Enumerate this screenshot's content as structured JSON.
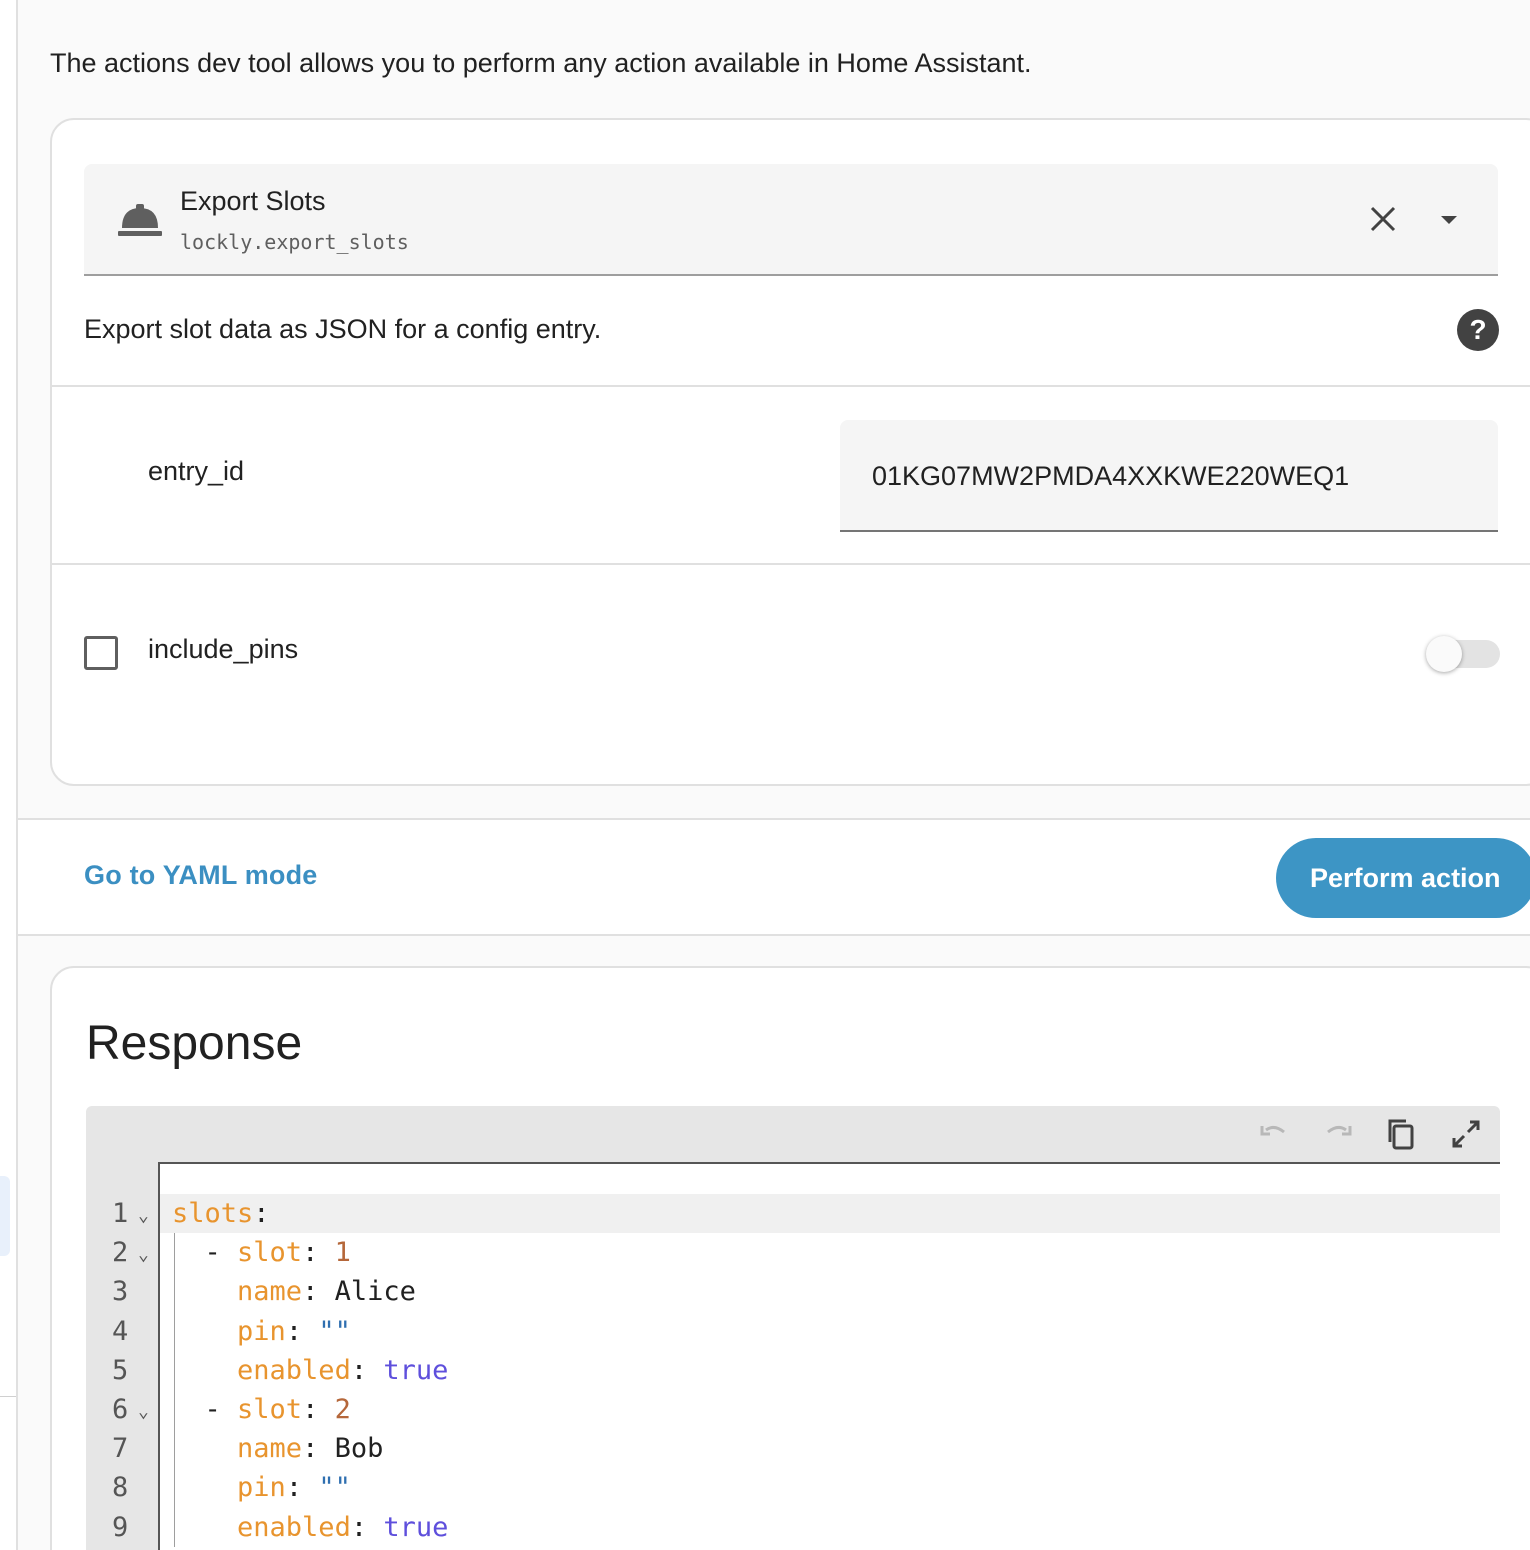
{
  "intro_text": "The actions dev tool allows you to perform any action available in Home Assistant.",
  "service": {
    "name": "Export Slots",
    "id": "lockly.export_slots",
    "icon": "bell-icon",
    "description": "Export slot data as JSON for a config entry."
  },
  "fields": {
    "entry_id": {
      "label": "entry_id",
      "value": "01KG07MW2PMDA4XXKWE220WEQ1"
    },
    "include_pins": {
      "label": "include_pins",
      "checked": false,
      "toggle_on": false
    }
  },
  "actions": {
    "yaml_mode_label": "Go to YAML mode",
    "perform_label": "Perform action"
  },
  "response": {
    "title": "Response",
    "toolbar": [
      "undo-icon",
      "redo-icon",
      "copy-icon",
      "fullscreen-icon"
    ],
    "line_numbers": [
      "1",
      "2",
      "3",
      "4",
      "5",
      "6",
      "7",
      "8",
      "9"
    ],
    "folds": [
      "1",
      "2",
      "6"
    ],
    "lines": [
      {
        "tokens": [
          {
            "t": "slots",
            "c": "k"
          },
          {
            "t": ":",
            "c": "p"
          }
        ]
      },
      {
        "tokens": [
          {
            "t": "  - ",
            "c": "p"
          },
          {
            "t": "slot",
            "c": "k"
          },
          {
            "t": ": ",
            "c": "p"
          },
          {
            "t": "1",
            "c": "n"
          }
        ]
      },
      {
        "tokens": [
          {
            "t": "    ",
            "c": "p"
          },
          {
            "t": "name",
            "c": "k"
          },
          {
            "t": ": ",
            "c": "p"
          },
          {
            "t": "Alice",
            "c": "p"
          }
        ]
      },
      {
        "tokens": [
          {
            "t": "    ",
            "c": "p"
          },
          {
            "t": "pin",
            "c": "k"
          },
          {
            "t": ": ",
            "c": "p"
          },
          {
            "t": "\"\"",
            "c": "s"
          }
        ]
      },
      {
        "tokens": [
          {
            "t": "    ",
            "c": "p"
          },
          {
            "t": "enabled",
            "c": "k"
          },
          {
            "t": ": ",
            "c": "p"
          },
          {
            "t": "true",
            "c": "b"
          }
        ]
      },
      {
        "tokens": [
          {
            "t": "  - ",
            "c": "p"
          },
          {
            "t": "slot",
            "c": "k"
          },
          {
            "t": ": ",
            "c": "p"
          },
          {
            "t": "2",
            "c": "n"
          }
        ]
      },
      {
        "tokens": [
          {
            "t": "    ",
            "c": "p"
          },
          {
            "t": "name",
            "c": "k"
          },
          {
            "t": ": ",
            "c": "p"
          },
          {
            "t": "Bob",
            "c": "p"
          }
        ]
      },
      {
        "tokens": [
          {
            "t": "    ",
            "c": "p"
          },
          {
            "t": "pin",
            "c": "k"
          },
          {
            "t": ": ",
            "c": "p"
          },
          {
            "t": "\"\"",
            "c": "s"
          }
        ]
      },
      {
        "tokens": [
          {
            "t": "    ",
            "c": "p"
          },
          {
            "t": "enabled",
            "c": "k"
          },
          {
            "t": ": ",
            "c": "p"
          },
          {
            "t": "true",
            "c": "b"
          }
        ]
      }
    ]
  },
  "colors": {
    "primary": "#3d95c5",
    "link": "#3b8fc2",
    "yaml_key": "#e8942e",
    "yaml_number": "#b5673a",
    "yaml_string": "#2f6fb0",
    "yaml_bool": "#5e4fdc"
  }
}
